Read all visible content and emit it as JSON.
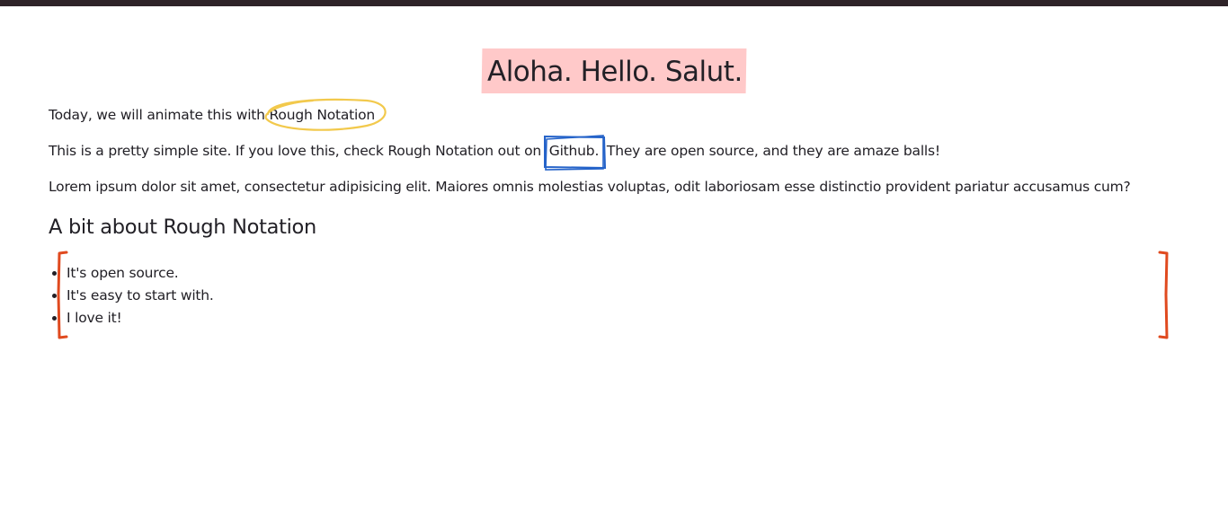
{
  "title": "Aloha. Hello. Salut.",
  "intro": {
    "before": "Today, we will animate this with",
    "highlight": "Rough Notation"
  },
  "description": {
    "before": "This is a pretty simple site. If you love this, check Rough Notation out on",
    "link": "Github.",
    "after": "They are open source, and they are amaze balls!"
  },
  "lorem": "Lorem ipsum dolor sit amet, consectetur adipisicing elit. Maiores omnis molestias voluptas, odit laboriosam esse distinctio provident pariatur accusamus cum?",
  "section_heading": "A bit about Rough Notation",
  "list_items": [
    "It's open source.",
    "It's easy to start with.",
    "I love it!"
  ],
  "colors": {
    "highlight_box": "#ffc9c9",
    "circle": "#f2c94c",
    "box": "#2563c9",
    "bracket": "#e04a1f",
    "top_bar": "#2e2328"
  }
}
